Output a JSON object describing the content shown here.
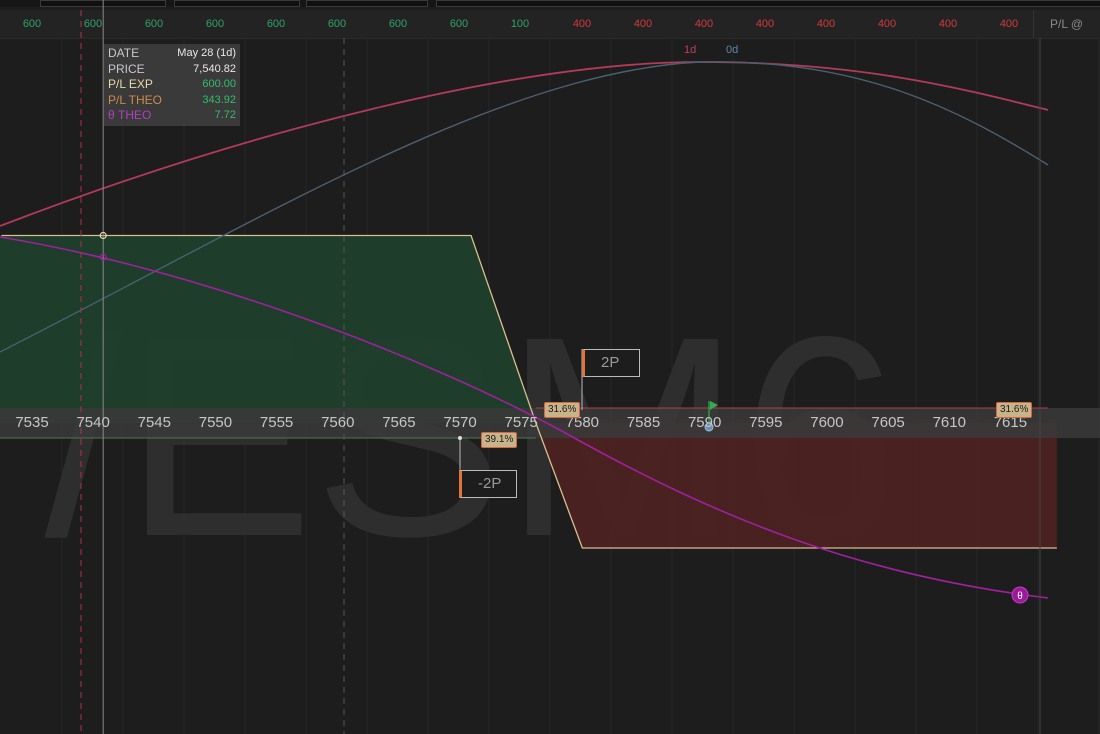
{
  "watermark": "/ESM6",
  "pl_header": {
    "right_label": "P/L @",
    "cells": [
      {
        "x": 32,
        "text": "600",
        "color": "#2fa36a"
      },
      {
        "x": 93,
        "text": "600",
        "color": "#2fa36a"
      },
      {
        "x": 154,
        "text": "600",
        "color": "#2fa36a"
      },
      {
        "x": 215,
        "text": "600",
        "color": "#2fa36a"
      },
      {
        "x": 276,
        "text": "600",
        "color": "#2fa36a"
      },
      {
        "x": 337,
        "text": "600",
        "color": "#2fa36a"
      },
      {
        "x": 398,
        "text": "600",
        "color": "#2fa36a"
      },
      {
        "x": 459,
        "text": "600",
        "color": "#2fa36a"
      },
      {
        "x": 520,
        "text": "100",
        "color": "#2fa36a"
      },
      {
        "x": 582,
        "text": "400",
        "color": "#d23a3a"
      },
      {
        "x": 643,
        "text": "400",
        "color": "#d23a3a"
      },
      {
        "x": 704,
        "text": "400",
        "color": "#d23a3a"
      },
      {
        "x": 765,
        "text": "400",
        "color": "#d23a3a"
      },
      {
        "x": 826,
        "text": "400",
        "color": "#d23a3a"
      },
      {
        "x": 887,
        "text": "400",
        "color": "#d23a3a"
      },
      {
        "x": 948,
        "text": "400",
        "color": "#d23a3a"
      },
      {
        "x": 1009,
        "text": "400",
        "color": "#d23a3a"
      }
    ]
  },
  "tooltip": {
    "rows": [
      {
        "label": "DATE",
        "value": "May 28 (1d)",
        "label_color": "#c8c8c8",
        "value_color": "#e8e8e8"
      },
      {
        "label": "PRICE",
        "value": "7,540.82",
        "label_color": "#c8c8c8",
        "value_color": "#e8e8e8"
      },
      {
        "label": "P/L EXP",
        "value": "600.00",
        "label_color": "#e8d8a8",
        "value_color": "#2fbf6a"
      },
      {
        "label": "P/L THEO",
        "value": "343.92",
        "label_color": "#d28a4a",
        "value_color": "#2fbf6a"
      },
      {
        "label": "θ THEO",
        "value": "7.72",
        "label_color": "#b040c0",
        "value_color": "#2fbf6a"
      }
    ]
  },
  "curve_labels": {
    "one_day": "1d",
    "zero_day": "0d",
    "theta": "θ"
  },
  "positions": {
    "short_put": "-2P",
    "long_put": "2P"
  },
  "probabilities": {
    "left": "39.1%",
    "mid": "31.6%",
    "right": "31.6%"
  },
  "colors": {
    "profit_fill": "#1f3f2b",
    "loss_fill": "#4c2222",
    "payoff_line": "#d8c08a",
    "curve_1d": "#b23a5a",
    "curve_0d": "#4a6070",
    "theta_line": "#a020a0",
    "axis_band": "#3a3a3a"
  },
  "chart_data": {
    "type": "line",
    "title": "",
    "xlabel": "",
    "x_ticks": [
      7535,
      7540,
      7545,
      7550,
      7555,
      7560,
      7565,
      7570,
      7575,
      7580,
      7585,
      7590,
      7595,
      7600,
      7605,
      7610,
      7615
    ],
    "xlim": [
      7532.5,
      7618.8
    ],
    "series": [
      {
        "name": "P/L EXP",
        "points": [
          [
            7532.5,
            600
          ],
          [
            7570.9,
            600
          ],
          [
            7576.2,
            0
          ],
          [
            7580,
            -400
          ],
          [
            7618.8,
            -400
          ]
        ]
      }
    ],
    "cursor": {
      "price": 7540.82,
      "date": "May 28 (1d)",
      "pl_exp": 600.0,
      "pl_theo": 343.92,
      "theta_theo": 7.72
    }
  }
}
